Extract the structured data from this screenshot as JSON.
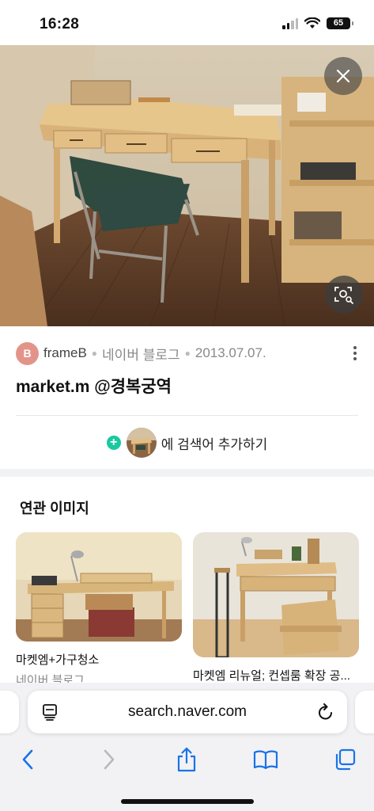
{
  "status_bar": {
    "time": "16:28",
    "battery": "65"
  },
  "post": {
    "avatar_letter": "B",
    "source_name": "frameB",
    "platform": "네이버 블로그",
    "date": "2013.07.07.",
    "title": "market.m @경복궁역"
  },
  "add_search": {
    "label": "에 검색어 추가하기"
  },
  "related": {
    "heading": "연관 이미지",
    "cards": [
      {
        "caption": "마켓엠+가구청소",
        "source": "네이버 블로그"
      },
      {
        "caption": "마켓엠 리뉴얼; 컨셉룸 확장 공...",
        "source": ""
      }
    ]
  },
  "browser": {
    "url": "search.naver.com"
  },
  "colors": {
    "accent_green": "#19c99f",
    "safari_blue": "#1a73e8",
    "avatar": "#e3948a"
  },
  "icons": [
    "close-icon",
    "lens-search-icon",
    "more-vertical-icon",
    "page-menu-icon",
    "reload-icon",
    "back-icon",
    "forward-icon",
    "share-icon",
    "bookmarks-icon",
    "tabs-icon"
  ]
}
